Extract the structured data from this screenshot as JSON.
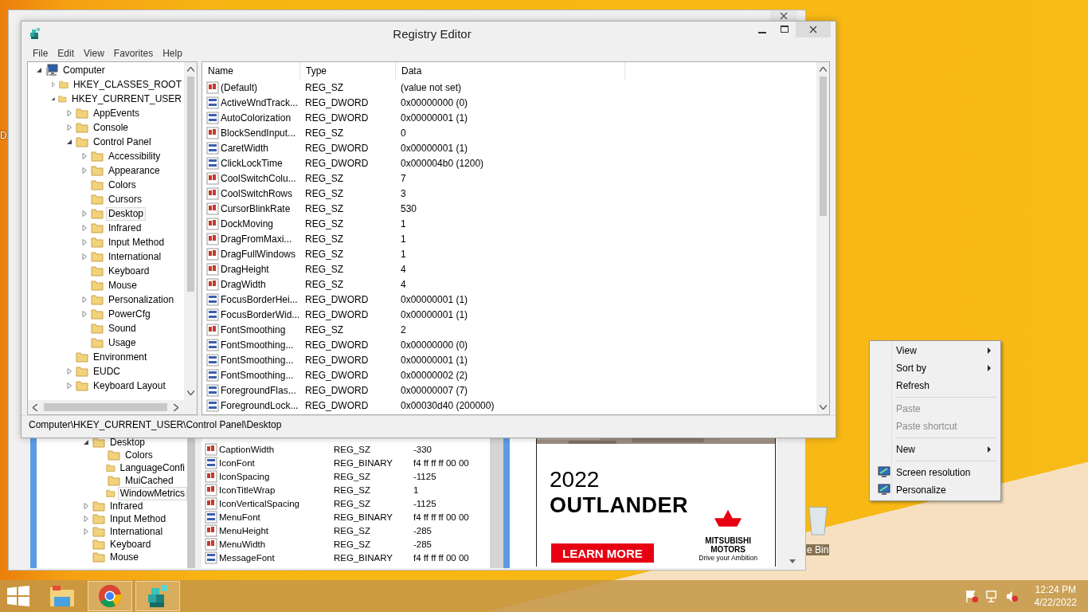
{
  "desktop": {
    "icons": [
      {
        "kind": "cut",
        "label": "D"
      },
      {
        "kind": "bin",
        "label": "e Bin"
      }
    ]
  },
  "back_window": {
    "tree": [
      {
        "label": "Desktop",
        "selected": false,
        "expanded": true,
        "children": [
          {
            "label": "Colors",
            "selected": false
          },
          {
            "label": "LanguageConfi",
            "selected": false
          },
          {
            "label": "MuiCached",
            "selected": false
          },
          {
            "label": "WindowMetrics",
            "selected": true
          }
        ]
      },
      {
        "label": "Infrared",
        "selected": false,
        "expanded": false
      },
      {
        "label": "Input Method",
        "selected": false,
        "expanded": false
      },
      {
        "label": "International",
        "selected": false,
        "expanded": false
      },
      {
        "label": "Keyboard",
        "selected": false
      },
      {
        "label": "Mouse",
        "selected": false
      }
    ],
    "rows": [
      {
        "kind": "string",
        "name": "CaptionWidth",
        "type": "REG_SZ",
        "data": "-330"
      },
      {
        "kind": "binary",
        "name": "IconFont",
        "type": "REG_BINARY",
        "data": "f4 ff ff ff 00 00"
      },
      {
        "kind": "string",
        "name": "IconSpacing",
        "type": "REG_SZ",
        "data": "-1125"
      },
      {
        "kind": "string",
        "name": "IconTitleWrap",
        "type": "REG_SZ",
        "data": "1"
      },
      {
        "kind": "string",
        "name": "IconVerticalSpacing",
        "type": "REG_SZ",
        "data": "-1125"
      },
      {
        "kind": "binary",
        "name": "MenuFont",
        "type": "REG_BINARY",
        "data": "f4 ff ff ff 00 00"
      },
      {
        "kind": "string",
        "name": "MenuHeight",
        "type": "REG_SZ",
        "data": "-285"
      },
      {
        "kind": "string",
        "name": "MenuWidth",
        "type": "REG_SZ",
        "data": "-285"
      },
      {
        "kind": "binary",
        "name": "MessageFont",
        "type": "REG_BINARY",
        "data": "f4 ff ff ff 00 00"
      }
    ],
    "ad": {
      "year": "2022",
      "model": "OUTLANDER",
      "button": "LEARN MORE",
      "brand_lines": [
        "MITSUBISHI",
        "MOTORS"
      ],
      "tagline": "Drive your Ambition"
    }
  },
  "registry_editor": {
    "title": "Registry Editor",
    "menu": [
      "File",
      "Edit",
      "View",
      "Favorites",
      "Help"
    ],
    "tree": [
      {
        "kind": "computer",
        "label": "Computer",
        "selected": false,
        "expanded": true,
        "children": [
          {
            "label": "HKEY_CLASSES_ROOT",
            "selected": false,
            "expanded": false
          },
          {
            "label": "HKEY_CURRENT_USER",
            "selected": false,
            "expanded": true,
            "children": [
              {
                "label": "AppEvents",
                "selected": false,
                "expanded": false
              },
              {
                "label": "Console",
                "selected": false,
                "expanded": false
              },
              {
                "label": "Control Panel",
                "selected": false,
                "expanded": true,
                "children": [
                  {
                    "label": "Accessibility",
                    "selected": false,
                    "expanded": false
                  },
                  {
                    "label": "Appearance",
                    "selected": false,
                    "expanded": false
                  },
                  {
                    "label": "Colors",
                    "selected": false
                  },
                  {
                    "label": "Cursors",
                    "selected": false
                  },
                  {
                    "label": "Desktop",
                    "selected": true,
                    "expanded": false
                  },
                  {
                    "label": "Infrared",
                    "selected": false,
                    "expanded": false
                  },
                  {
                    "label": "Input Method",
                    "selected": false,
                    "expanded": false
                  },
                  {
                    "label": "International",
                    "selected": false,
                    "expanded": false
                  },
                  {
                    "label": "Keyboard",
                    "selected": false
                  },
                  {
                    "label": "Mouse",
                    "selected": false
                  },
                  {
                    "label": "Personalization",
                    "selected": false,
                    "expanded": false
                  },
                  {
                    "label": "PowerCfg",
                    "selected": false,
                    "expanded": false
                  },
                  {
                    "label": "Sound",
                    "selected": false
                  },
                  {
                    "label": "Usage",
                    "selected": false
                  }
                ]
              },
              {
                "label": "Environment",
                "selected": false
              },
              {
                "label": "EUDC",
                "selected": false,
                "expanded": false
              },
              {
                "label": "Keyboard Layout",
                "selected": false,
                "expanded": false
              }
            ]
          }
        ]
      }
    ],
    "columns": [
      "Name",
      "Type",
      "Data"
    ],
    "rows": [
      {
        "kind": "string",
        "name": "(Default)",
        "type": "REG_SZ",
        "data": "(value not set)"
      },
      {
        "kind": "binary",
        "name": "ActiveWndTrack...",
        "type": "REG_DWORD",
        "data": "0x00000000 (0)"
      },
      {
        "kind": "binary",
        "name": "AutoColorization",
        "type": "REG_DWORD",
        "data": "0x00000001 (1)"
      },
      {
        "kind": "string",
        "name": "BlockSendInput...",
        "type": "REG_SZ",
        "data": "0"
      },
      {
        "kind": "binary",
        "name": "CaretWidth",
        "type": "REG_DWORD",
        "data": "0x00000001 (1)"
      },
      {
        "kind": "binary",
        "name": "ClickLockTime",
        "type": "REG_DWORD",
        "data": "0x000004b0 (1200)"
      },
      {
        "kind": "string",
        "name": "CoolSwitchColu...",
        "type": "REG_SZ",
        "data": "7"
      },
      {
        "kind": "string",
        "name": "CoolSwitchRows",
        "type": "REG_SZ",
        "data": "3"
      },
      {
        "kind": "string",
        "name": "CursorBlinkRate",
        "type": "REG_SZ",
        "data": "530"
      },
      {
        "kind": "string",
        "name": "DockMoving",
        "type": "REG_SZ",
        "data": "1"
      },
      {
        "kind": "string",
        "name": "DragFromMaxi...",
        "type": "REG_SZ",
        "data": "1"
      },
      {
        "kind": "string",
        "name": "DragFullWindows",
        "type": "REG_SZ",
        "data": "1"
      },
      {
        "kind": "string",
        "name": "DragHeight",
        "type": "REG_SZ",
        "data": "4"
      },
      {
        "kind": "string",
        "name": "DragWidth",
        "type": "REG_SZ",
        "data": "4"
      },
      {
        "kind": "binary",
        "name": "FocusBorderHei...",
        "type": "REG_DWORD",
        "data": "0x00000001 (1)"
      },
      {
        "kind": "binary",
        "name": "FocusBorderWid...",
        "type": "REG_DWORD",
        "data": "0x00000001 (1)"
      },
      {
        "kind": "string",
        "name": "FontSmoothing",
        "type": "REG_SZ",
        "data": "2"
      },
      {
        "kind": "binary",
        "name": "FontSmoothing...",
        "type": "REG_DWORD",
        "data": "0x00000000 (0)"
      },
      {
        "kind": "binary",
        "name": "FontSmoothing...",
        "type": "REG_DWORD",
        "data": "0x00000001 (1)"
      },
      {
        "kind": "binary",
        "name": "FontSmoothing...",
        "type": "REG_DWORD",
        "data": "0x00000002 (2)"
      },
      {
        "kind": "binary",
        "name": "ForegroundFlas...",
        "type": "REG_DWORD",
        "data": "0x00000007 (7)"
      },
      {
        "kind": "binary",
        "name": "ForegroundLock...",
        "type": "REG_DWORD",
        "data": "0x00030d40 (200000)"
      }
    ],
    "status_bar": "Computer\\HKEY_CURRENT_USER\\Control Panel\\Desktop"
  },
  "context_menu": {
    "items": [
      {
        "kind": "submenu",
        "label": "View",
        "disabled": false
      },
      {
        "kind": "submenu",
        "label": "Sort by",
        "disabled": false
      },
      {
        "kind": "command",
        "label": "Refresh",
        "disabled": false
      },
      {
        "kind": "separator"
      },
      {
        "kind": "command",
        "label": "Paste",
        "disabled": true
      },
      {
        "kind": "command",
        "label": "Paste shortcut",
        "disabled": true
      },
      {
        "kind": "separator"
      },
      {
        "kind": "submenu",
        "label": "New",
        "disabled": false
      },
      {
        "kind": "separator"
      },
      {
        "kind": "icon-command",
        "label": "Screen resolution",
        "disabled": false
      },
      {
        "kind": "icon-command",
        "label": "Personalize",
        "disabled": false
      }
    ]
  },
  "taskbar": {
    "apps": [
      {
        "kind": "folder",
        "running": false
      },
      {
        "kind": "browser",
        "running": true
      },
      {
        "kind": "registry",
        "running": true
      }
    ],
    "time": "12:24 PM",
    "date": "4/22/2022"
  }
}
